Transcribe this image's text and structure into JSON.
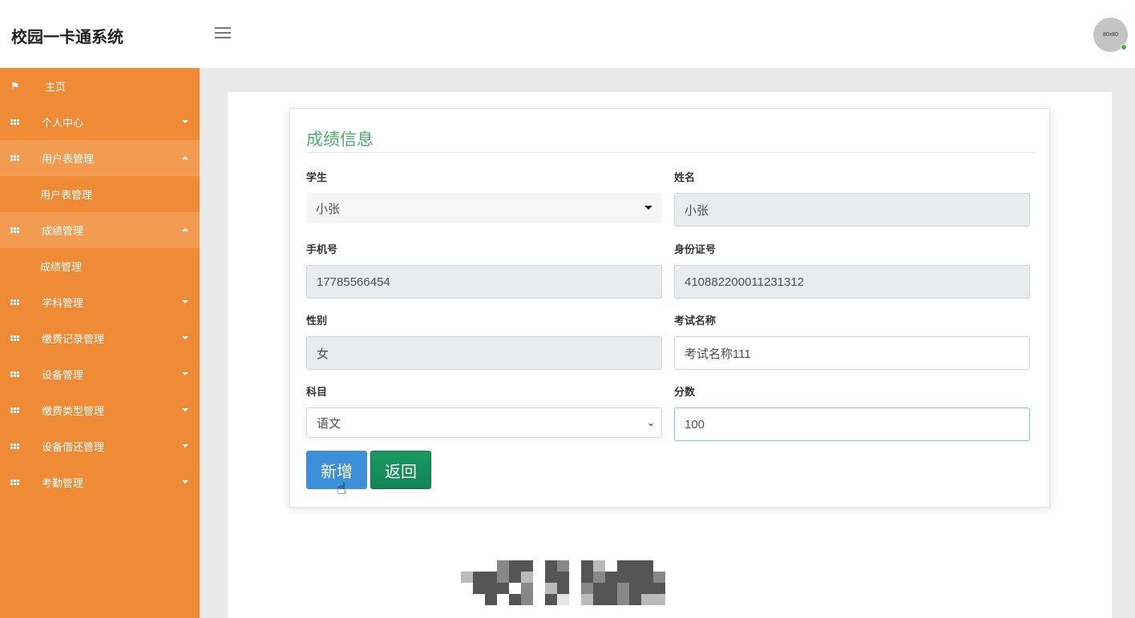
{
  "header": {
    "title": "校园一卡通系统",
    "avatar_text": "80x80"
  },
  "sidebar": {
    "items": [
      {
        "label": "主页",
        "icon": "flag-icon"
      },
      {
        "label": "个人中心",
        "icon": "grid-icon"
      },
      {
        "label": "用户表管理",
        "icon": "grid-icon",
        "open": true,
        "sub": "用户表管理"
      },
      {
        "label": "成绩管理",
        "icon": "grid-icon",
        "open": true,
        "sub": "成绩管理"
      },
      {
        "label": "学科管理",
        "icon": "grid-icon"
      },
      {
        "label": "缴费记录管理",
        "icon": "grid-icon"
      },
      {
        "label": "设备管理",
        "icon": "grid-icon"
      },
      {
        "label": "缴费类型管理",
        "icon": "grid-icon"
      },
      {
        "label": "设备借还管理",
        "icon": "grid-icon"
      },
      {
        "label": "考勤管理",
        "icon": "grid-icon"
      }
    ]
  },
  "form": {
    "title": "成绩信息",
    "student": {
      "label": "学生",
      "value": "小张"
    },
    "name": {
      "label": "姓名",
      "value": "小张"
    },
    "phone": {
      "label": "手机号",
      "value": "17785566454"
    },
    "idcard": {
      "label": "身份证号",
      "value": "410882200011231312"
    },
    "gender": {
      "label": "性别",
      "value": "女"
    },
    "exam": {
      "label": "考试名称",
      "value": "考试名称111"
    },
    "subject": {
      "label": "科目",
      "value": "语文"
    },
    "score": {
      "label": "分数",
      "value": "100"
    },
    "add_label": "新增",
    "back_label": "返回"
  }
}
